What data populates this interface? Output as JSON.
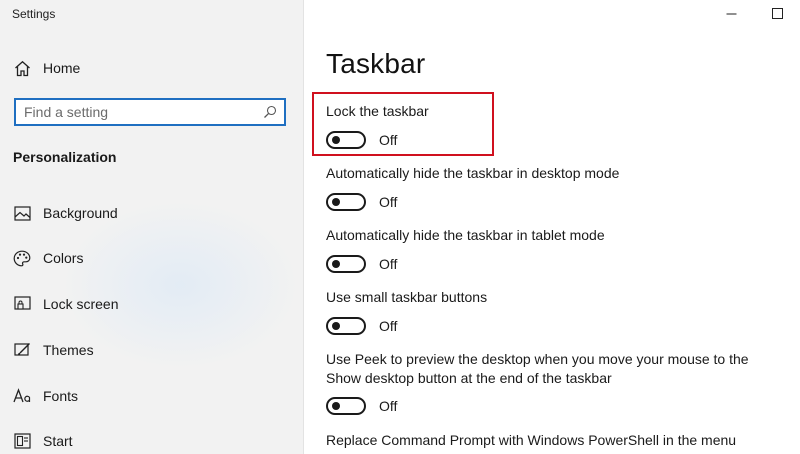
{
  "window": {
    "title": "Settings"
  },
  "sidebar": {
    "home_label": "Home",
    "search_placeholder": "Find a setting",
    "section_title": "Personalization",
    "items": [
      {
        "label": "Background",
        "icon": "image-icon"
      },
      {
        "label": "Colors",
        "icon": "palette-icon"
      },
      {
        "label": "Lock screen",
        "icon": "lock-screen-icon"
      },
      {
        "label": "Themes",
        "icon": "themes-icon"
      },
      {
        "label": "Fonts",
        "icon": "fonts-icon"
      },
      {
        "label": "Start",
        "icon": "start-icon"
      }
    ]
  },
  "main": {
    "title": "Taskbar",
    "settings": [
      {
        "label": "Lock the taskbar",
        "state": "Off",
        "highlighted": true
      },
      {
        "label": "Automatically hide the taskbar in desktop mode",
        "state": "Off"
      },
      {
        "label": "Automatically hide the taskbar in tablet mode",
        "state": "Off"
      },
      {
        "label": "Use small taskbar buttons",
        "state": "Off"
      },
      {
        "label_line1": "Use Peek to preview the desktop when you move your mouse to the",
        "label_line2": "Show desktop button at the end of the taskbar",
        "state": "Off"
      },
      {
        "label": "Replace Command Prompt with Windows PowerShell in the menu"
      }
    ]
  },
  "colors": {
    "accent": "#1f6fc1",
    "highlight": "#d0101e"
  }
}
